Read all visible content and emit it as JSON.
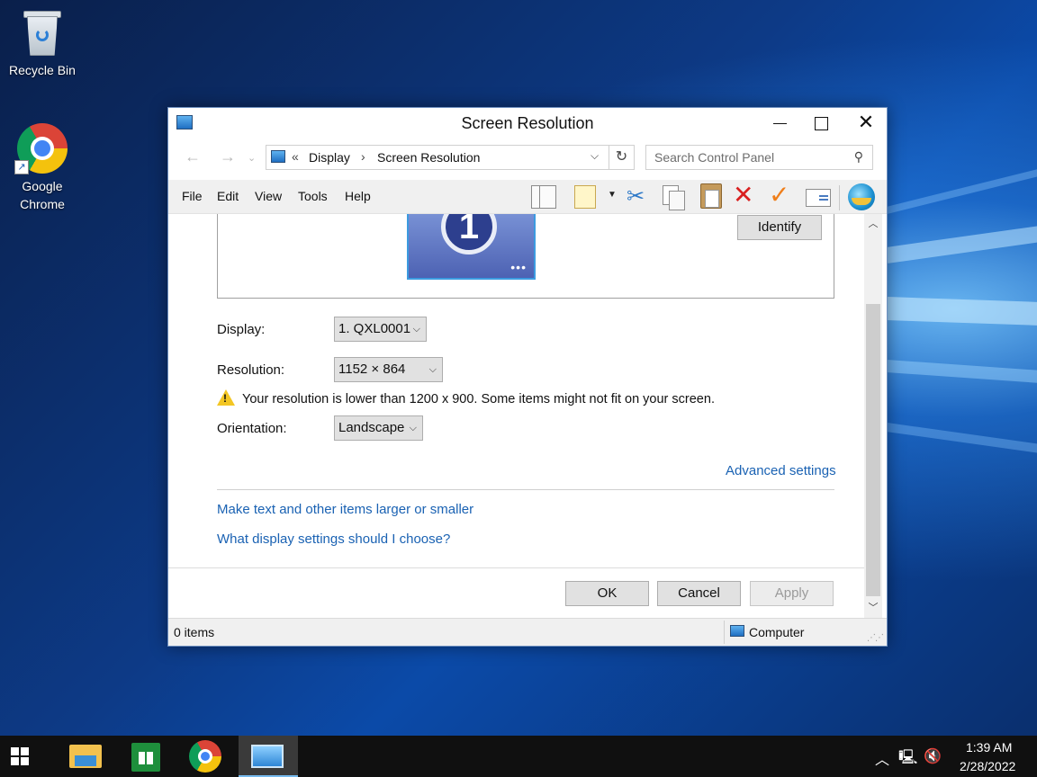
{
  "desktop": {
    "icons": [
      {
        "label": "Recycle Bin"
      },
      {
        "label": "Google Chrome"
      }
    ]
  },
  "window": {
    "title": "Screen Resolution",
    "address": {
      "overflow": "«",
      "crumbs": [
        "Display",
        "Screen Resolution"
      ],
      "separator": "›"
    },
    "search": {
      "placeholder": "Search Control Panel"
    },
    "menu": [
      "File",
      "Edit",
      "View",
      "Tools",
      "Help"
    ],
    "toolbar_icons": [
      "layout-icon",
      "properties-icon",
      "cut-icon",
      "copy-icon",
      "paste-icon",
      "delete-icon",
      "check-icon",
      "mail-icon",
      "globe-icon"
    ],
    "monitor": {
      "number": "1",
      "identify_label": "Identify"
    },
    "display": {
      "label": "Display:",
      "value": "1. QXL0001"
    },
    "resolution": {
      "label": "Resolution:",
      "value": "1152 × 864"
    },
    "warning": "Your resolution is lower than 1200 x 900. Some items might not fit on your screen.",
    "orientation": {
      "label": "Orientation:",
      "value": "Landscape"
    },
    "links": {
      "advanced": "Advanced settings",
      "text_size": "Make text and other items larger or smaller",
      "which_settings": "What display settings should I choose?"
    },
    "buttons": {
      "ok": "OK",
      "cancel": "Cancel",
      "apply": "Apply"
    },
    "status": {
      "items": "0 items",
      "location": "Computer"
    }
  },
  "taskbar": {
    "clock": {
      "time": "1:39 AM",
      "date": "2/28/2022"
    }
  },
  "colors": {
    "link": "#1a62b3",
    "taskbar": "#101010",
    "accent": "#76b9ed"
  }
}
